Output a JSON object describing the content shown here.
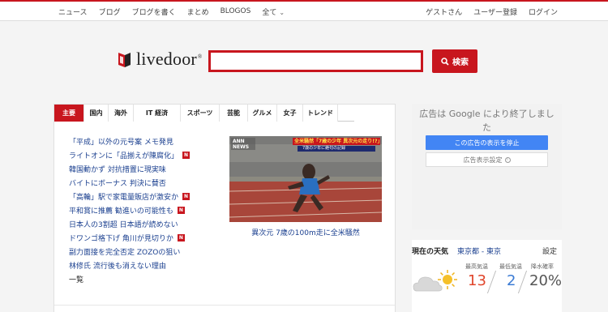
{
  "topnav": {
    "items": [
      "ニュース",
      "ブログ",
      "ブログを書く",
      "まとめ",
      "BLOGOS",
      "全て"
    ],
    "right": [
      "ゲストさん",
      "ユーザー登録",
      "ログイン"
    ]
  },
  "logo": {
    "text": "livedoor",
    "reg": "®"
  },
  "search": {
    "value": "",
    "placeholder": "",
    "button_label": "検索"
  },
  "tabs": [
    "主要",
    "国内",
    "海外",
    "IT 経済",
    "スポーツ",
    "芸能",
    "グルメ",
    "女子",
    "トレンド"
  ],
  "headlines": [
    {
      "text": "「平成」以外の元号案 メモ発見",
      "new": false
    },
    {
      "text": "ライトオンに「品揃えが陳腐化」",
      "new": true
    },
    {
      "text": "韓国動かず 対抗措置に現実味",
      "new": false
    },
    {
      "text": "バイトにボーナス 判決に賛否",
      "new": false
    },
    {
      "text": "「高輪」駅で家電量販店が激安か",
      "new": true
    },
    {
      "text": "平和賞に推薦 勧進いの可能性も",
      "new": true
    },
    {
      "text": "日本人の3割超 日本語が読めない",
      "new": false
    },
    {
      "text": "ドワンゴ格下げ 角川が見切りか",
      "new": true
    },
    {
      "text": "副力面接を完全否定 ZOZOの狙い",
      "new": false
    },
    {
      "text": "林修氏 流行後も消えない理由",
      "new": false
    }
  ],
  "new_badge": "N",
  "more_label": "一覧",
  "photo": {
    "caption": "異次元 7歳の100m走に全米騒然",
    "overlay_brand": "ANN NEWS",
    "overlay_headline": "全米騒然「7歳の少年 異次元の走り!?」",
    "overlay_sub": "7歳の少年に絶句の記録"
  },
  "ad": {
    "title": "広告は Google により終了しました",
    "stop_label": "この広告の表示を停止",
    "settings_label": "広告表示設定",
    "info_glyph": "i"
  },
  "weather": {
    "title": "現在の天気",
    "location": "東京都 - 東京",
    "settings_label": "設定",
    "label_high": "最高気温",
    "label_low": "最低気温",
    "label_rain": "降水確率",
    "high": "13",
    "low": "2",
    "rain": "20%",
    "icon": "cloud-sun-icon"
  },
  "colors": {
    "brand_red": "#c8161e",
    "link_blue": "#1a3f8f",
    "google_blue": "#4285f4",
    "temp_high": "#e0452b",
    "temp_low": "#3b7bd4"
  }
}
